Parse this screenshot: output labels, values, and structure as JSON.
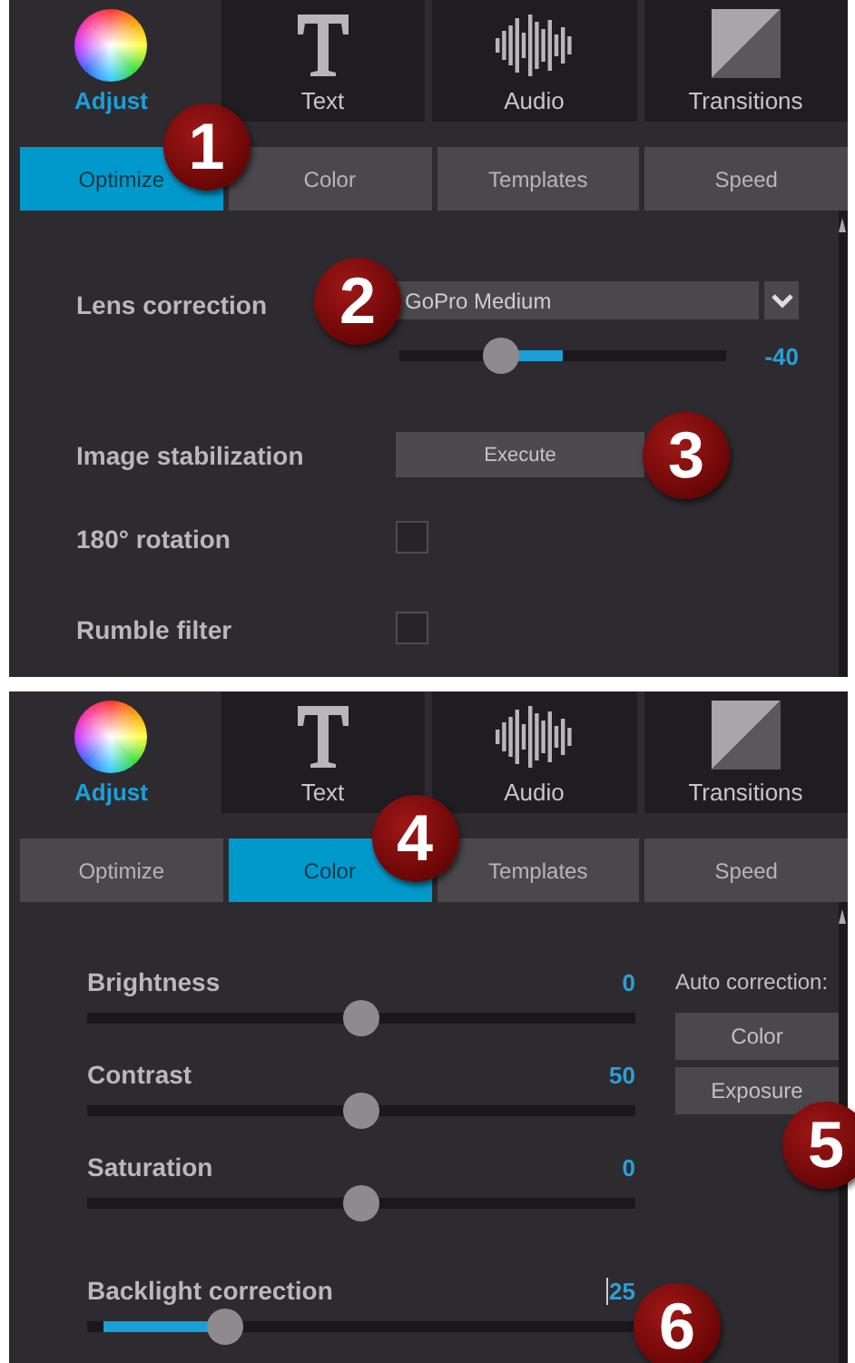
{
  "panels": [
    {
      "categories": [
        {
          "label": "Adjust",
          "selected": true
        },
        {
          "label": "Text",
          "selected": false
        },
        {
          "label": "Audio",
          "selected": false
        },
        {
          "label": "Transitions",
          "selected": false
        }
      ],
      "subtabs": [
        {
          "label": "Optimize",
          "selected": true,
          "callout": "1"
        },
        {
          "label": "Color",
          "selected": false
        },
        {
          "label": "Templates",
          "selected": false
        },
        {
          "label": "Speed",
          "selected": false
        }
      ],
      "rows": [
        {
          "kind": "dropdown",
          "label": "Lens correction",
          "value": "GoPro Medium",
          "callout": "2",
          "level": 0.31,
          "reading": "-40"
        },
        {
          "kind": "button",
          "label": "Image stabilization",
          "button": "Execute",
          "callout": "3"
        },
        {
          "kind": "checkbox",
          "label": "180° rotation",
          "checked": false
        },
        {
          "kind": "checkbox",
          "label": "Rumble filter",
          "checked": false
        }
      ]
    },
    {
      "categories": [
        {
          "label": "Adjust",
          "selected": true
        },
        {
          "label": "Text",
          "selected": false
        },
        {
          "label": "Audio",
          "selected": false
        },
        {
          "label": "Transitions",
          "selected": false
        }
      ],
      "subtabs": [
        {
          "label": "Optimize",
          "selected": false
        },
        {
          "label": "Color",
          "selected": true,
          "callout": "4"
        },
        {
          "label": "Templates",
          "selected": false
        },
        {
          "label": "Speed",
          "selected": false
        }
      ],
      "sliders": [
        {
          "kind": "centered",
          "label": "Brightness",
          "reading": "0",
          "level": 0.5,
          "focused": false
        },
        {
          "kind": "centered",
          "label": "Contrast",
          "reading": "50",
          "level": 0.5,
          "focused": false
        },
        {
          "kind": "centered",
          "label": "Saturation",
          "reading": "0",
          "level": 0.5,
          "focused": false
        },
        {
          "kind": "from_start",
          "label": "Backlight correction",
          "reading": "25",
          "level": 0.25,
          "focused": true,
          "callout": "6"
        }
      ],
      "auto": {
        "label": "Auto correction:",
        "buttons": [
          {
            "label": "Color"
          },
          {
            "label": "Exposure",
            "callout": "5"
          }
        ]
      }
    }
  ]
}
